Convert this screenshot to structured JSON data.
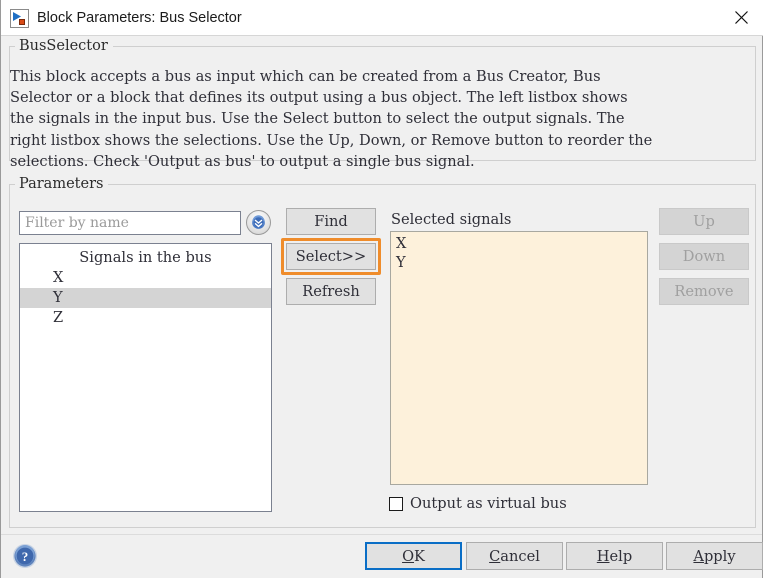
{
  "window": {
    "title": "Block Parameters: Bus Selector",
    "icon": "simulink-block-icon",
    "close_label": "close-icon"
  },
  "bus_group": {
    "legend": "BusSelector",
    "description": "This block accepts a bus as input which can be created from a Bus Creator, Bus\nSelector or a block that defines its output using a bus object. The left listbox shows\nthe signals in the input bus. Use the Select button to select the output signals. The\nright listbox shows the selections. Use the Up, Down, or Remove button to reorder the\nselections. Check 'Output as bus' to output a single bus signal."
  },
  "parameters": {
    "legend": "Parameters",
    "filter": {
      "placeholder": "Filter by name",
      "value": "",
      "dropdown_icon": "double-chevron-down-icon"
    },
    "signals_listbox": {
      "header": "Signals in the bus",
      "items": [
        {
          "label": "X",
          "selected": false
        },
        {
          "label": "Y",
          "selected": true
        },
        {
          "label": "Z",
          "selected": false
        }
      ]
    },
    "middle_buttons": [
      {
        "label": "Find",
        "name": "find-button",
        "highlighted": false
      },
      {
        "label": "Select>>",
        "name": "select-button",
        "highlighted": true
      },
      {
        "label": "Refresh",
        "name": "refresh-button",
        "highlighted": false
      }
    ],
    "selected_signals": {
      "label": "Selected signals",
      "items": [
        {
          "label": "X"
        },
        {
          "label": "Y"
        }
      ]
    },
    "right_buttons": [
      {
        "label": "Up",
        "name": "up-button",
        "enabled": false
      },
      {
        "label": "Down",
        "name": "down-button",
        "enabled": false
      },
      {
        "label": "Remove",
        "name": "remove-button",
        "enabled": false
      }
    ],
    "virtual_bus": {
      "label": "Output as virtual bus",
      "checked": false
    }
  },
  "footer": {
    "help_icon": "help-circle-icon",
    "buttons": [
      {
        "label": "OK",
        "mnemonic": "O",
        "name": "ok-button",
        "default": true
      },
      {
        "label": "Cancel",
        "mnemonic": "C",
        "name": "cancel-button",
        "default": false
      },
      {
        "label": "Help",
        "mnemonic": "H",
        "name": "help-button",
        "default": false
      },
      {
        "label": "Apply",
        "mnemonic": "A",
        "name": "apply-button",
        "default": false
      }
    ]
  },
  "colors": {
    "dialog_background": "#f0f0f0",
    "titlebar_background": "#ffffff",
    "listbox_background": "#ffffff",
    "selected_listbox_background": "#fdf1db",
    "list_selection": "#d4d4d4",
    "highlight_accent": "#ef8c2b",
    "focus_accent": "#0a6ec6",
    "button_face": "#e1e1e1",
    "disabled_button_face": "#d4d4d4",
    "disabled_text": "#a0a0a0",
    "text": "#2f2f38"
  }
}
